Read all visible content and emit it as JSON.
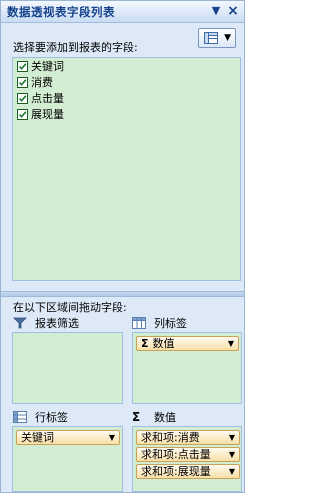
{
  "title": "数据透视表字段列表",
  "title_buttons": {
    "dropdown": "▼",
    "close": "×"
  },
  "choose_fields_label": "选择要添加到报表的字段:",
  "fields": [
    {
      "label": "关键词",
      "checked": true
    },
    {
      "label": "消费",
      "checked": true
    },
    {
      "label": "点击量",
      "checked": true
    },
    {
      "label": "展现量",
      "checked": true
    }
  ],
  "drag_label": "在以下区域间拖动字段:",
  "areas": {
    "report_filter": {
      "label": "报表筛选",
      "items": []
    },
    "column_labels": {
      "label": "列标签",
      "items": [
        "数值"
      ]
    },
    "row_labels": {
      "label": "行标签",
      "items": [
        "关键词"
      ]
    },
    "values": {
      "label": "数值",
      "items": [
        "求和项:消费",
        "求和项:点击量",
        "求和项:展现量"
      ]
    }
  },
  "sigma_symbol": "Σ",
  "dropdown_arrow": "▼",
  "colors": {
    "drop_bg": "#d3edd2",
    "chip_bg": "#f7dfa6",
    "title_text": "#15428b",
    "panel_bg": "#dde9f7"
  },
  "icons": {
    "layout": "layout-icon",
    "filter": "filter-icon",
    "columns": "column-labels-icon",
    "rows": "row-labels-icon",
    "values": "sigma-icon"
  }
}
